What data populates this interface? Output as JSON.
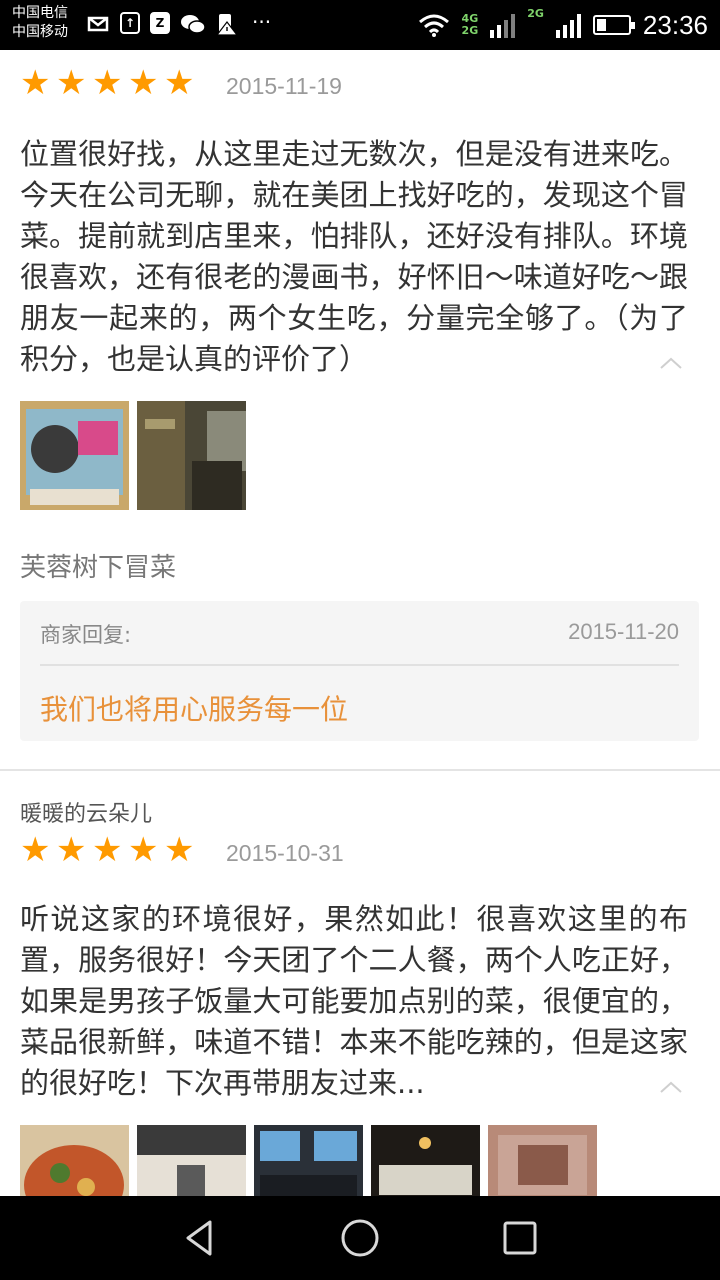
{
  "status_bar": {
    "carrier_1": "中国电信",
    "carrier_2": "中国移动",
    "net_1": "4G",
    "net_2": "2G",
    "net_3": "2G",
    "time": "23:36",
    "icons": [
      "message-icon",
      "upload-icon",
      "z-icon",
      "wechat-icon",
      "alert-icon",
      "more-icon",
      "wifi-icon",
      "signal-icon",
      "battery-icon"
    ]
  },
  "reviews": [
    {
      "rating": 5,
      "date": "2015-11-19",
      "text": "位置很好找，从这里走过无数次，但是没有进来吃。今天在公司无聊，就在美团上找好吃的，发现这个冒菜。提前就到店里来，怕排队，还好没有排队。环境很喜欢，还有很老的漫画书，好怀旧～味道好吃～跟朋友一起来的，两个女生吃，分量完全够了。（为了积分，也是认真的评价了）",
      "shop_name": "芙蓉树下冒菜",
      "reply": {
        "label": "商家回复:",
        "date": "2015-11-20",
        "text": "我们也将用心服务每一位"
      }
    },
    {
      "username": "暖暖的云朵儿",
      "rating": 5,
      "date": "2015-10-31",
      "text": "听说这家的环境很好，果然如此！很喜欢这里的布置，服务很好！今天团了个二人餐，两个人吃正好，如果是男孩子饭量大可能要加点别的菜，很便宜的，菜品很新鲜，味道不错！本来不能吃辣的，但是这家的很好吃！下次再带朋友过来..."
    }
  ],
  "colors": {
    "star": "#ff9a00",
    "reply_text": "#e8913a",
    "reply_bg": "#f5f5f5"
  }
}
